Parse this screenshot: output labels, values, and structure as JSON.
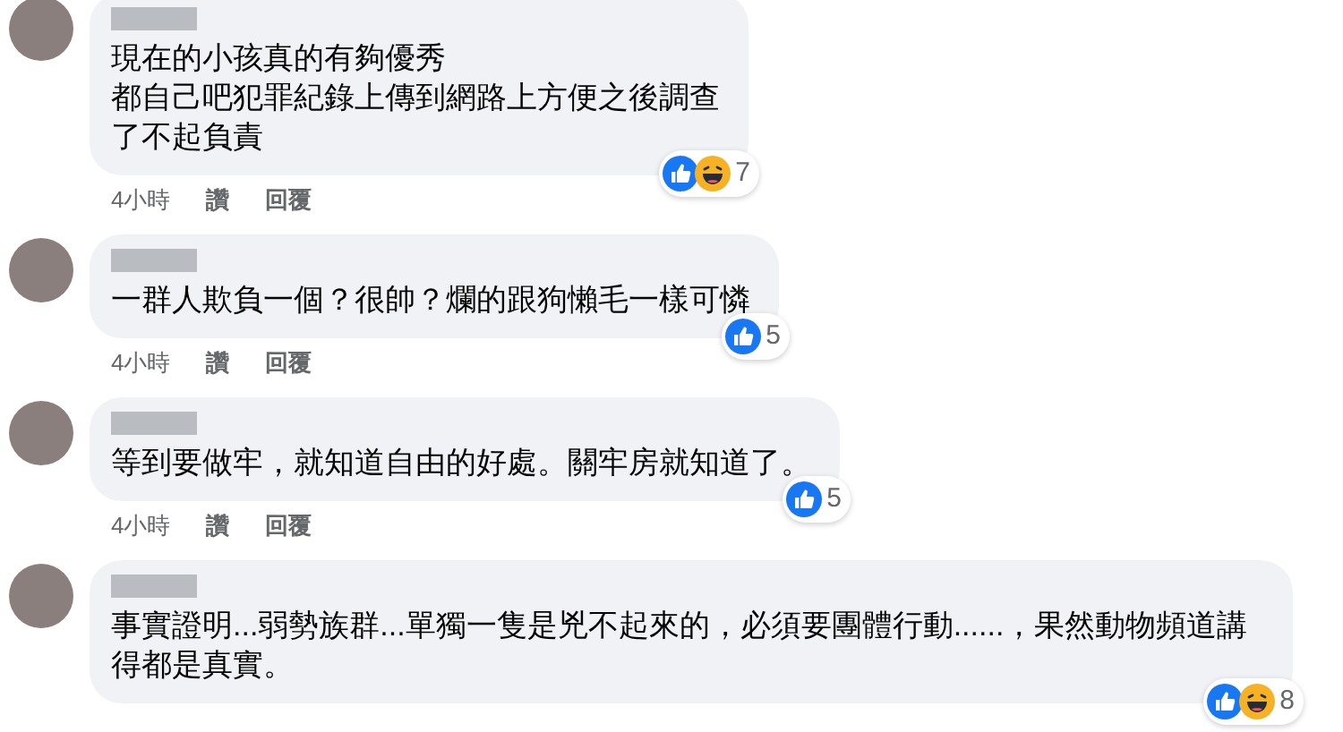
{
  "comments": [
    {
      "lines": [
        "現在的小孩真的有夠優秀",
        "都自己吧犯罪紀錄上傳到網路上方便之後調查",
        "了不起負責"
      ],
      "reactions": [
        {
          "kind": "like"
        },
        {
          "kind": "haha"
        }
      ],
      "reaction_count": "7",
      "time": "4小時",
      "like": "讚",
      "reply": "回覆"
    },
    {
      "lines": [
        "一群人欺負一個？很帥？爛的跟狗懶毛一樣可憐"
      ],
      "reactions": [
        {
          "kind": "like"
        }
      ],
      "reaction_count": "5",
      "time": "4小時",
      "like": "讚",
      "reply": "回覆"
    },
    {
      "lines": [
        "等到要做牢，就知道自由的好處。關牢房就知道了。"
      ],
      "reactions": [
        {
          "kind": "like"
        }
      ],
      "reaction_count": "5",
      "time": "4小時",
      "like": "讚",
      "reply": "回覆"
    },
    {
      "lines": [
        "事實證明...弱勢族群...單獨一隻是兇不起來的，必須要團體行動......，果然動物頻道講得都是真實。"
      ],
      "reactions": [
        {
          "kind": "like"
        },
        {
          "kind": "haha"
        }
      ],
      "reaction_count": "8"
    }
  ]
}
